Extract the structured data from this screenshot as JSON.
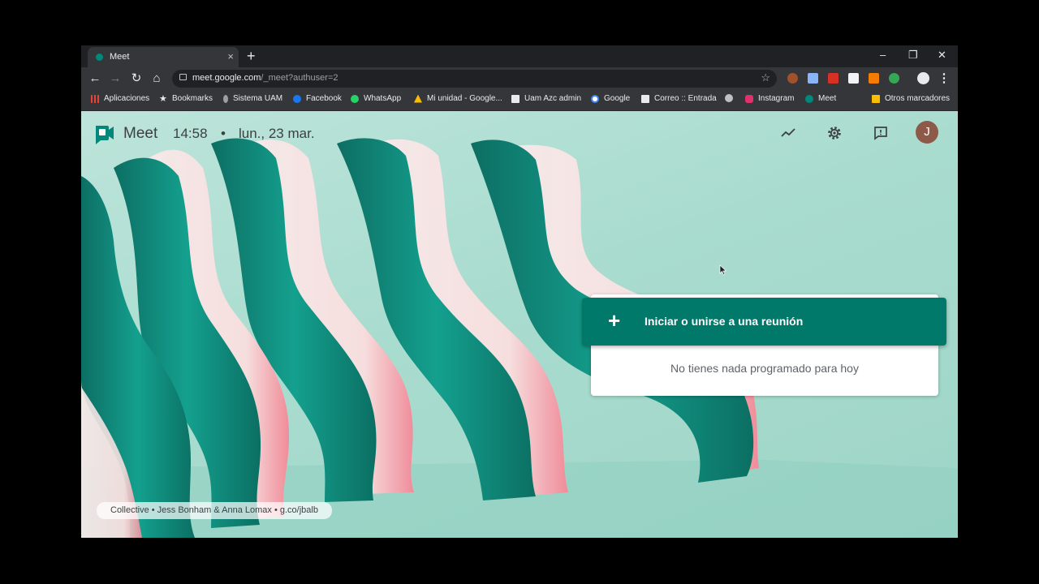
{
  "browser": {
    "tab": {
      "title": "Meet",
      "close": "×"
    },
    "new_tab": "+",
    "window_controls": {
      "minimize": "–",
      "restore": "❐",
      "close": "✕"
    },
    "nav": {
      "back": "←",
      "forward": "→",
      "reload": "↻",
      "home": "⌂"
    },
    "url": {
      "host": "meet.google.com",
      "path": "/_meet?authuser=2"
    },
    "bookmarks": [
      {
        "label": "Aplicaciones",
        "color": "#ea4335"
      },
      {
        "label": "Bookmarks",
        "color": "#bdc1c6"
      },
      {
        "label": "Sistema UAM",
        "color": "#9aa0a6"
      },
      {
        "label": "Facebook",
        "color": "#1877f2"
      },
      {
        "label": "WhatsApp",
        "color": "#25d366"
      },
      {
        "label": "Mi unidad - Google...",
        "color": "#fbbc04"
      },
      {
        "label": "Uam Azc admin",
        "color": "#e8eaed"
      },
      {
        "label": "Google",
        "color": "#4285f4"
      },
      {
        "label": "Correo :: Entrada",
        "color": "#e8eaed"
      },
      {
        "label": "",
        "color": "#bdc1c6"
      },
      {
        "label": "Instagram",
        "color": "#e1306c"
      },
      {
        "label": "Meet",
        "color": "#00897b"
      }
    ],
    "other_bookmarks": "Otros marcadores"
  },
  "meet": {
    "app_name": "Meet",
    "time": "14:58",
    "separator": "•",
    "date": "lun., 23 mar.",
    "avatar_letter": "J",
    "primary_button": "Iniciar o unirse a una reunión",
    "empty_state": "No tienes nada programado para hoy",
    "credit": "Collective  •  Jess Bonham & Anna Lomax  •  g.co/jbalb"
  },
  "colors": {
    "accent": "#00796b",
    "background": "#a9dccf"
  }
}
